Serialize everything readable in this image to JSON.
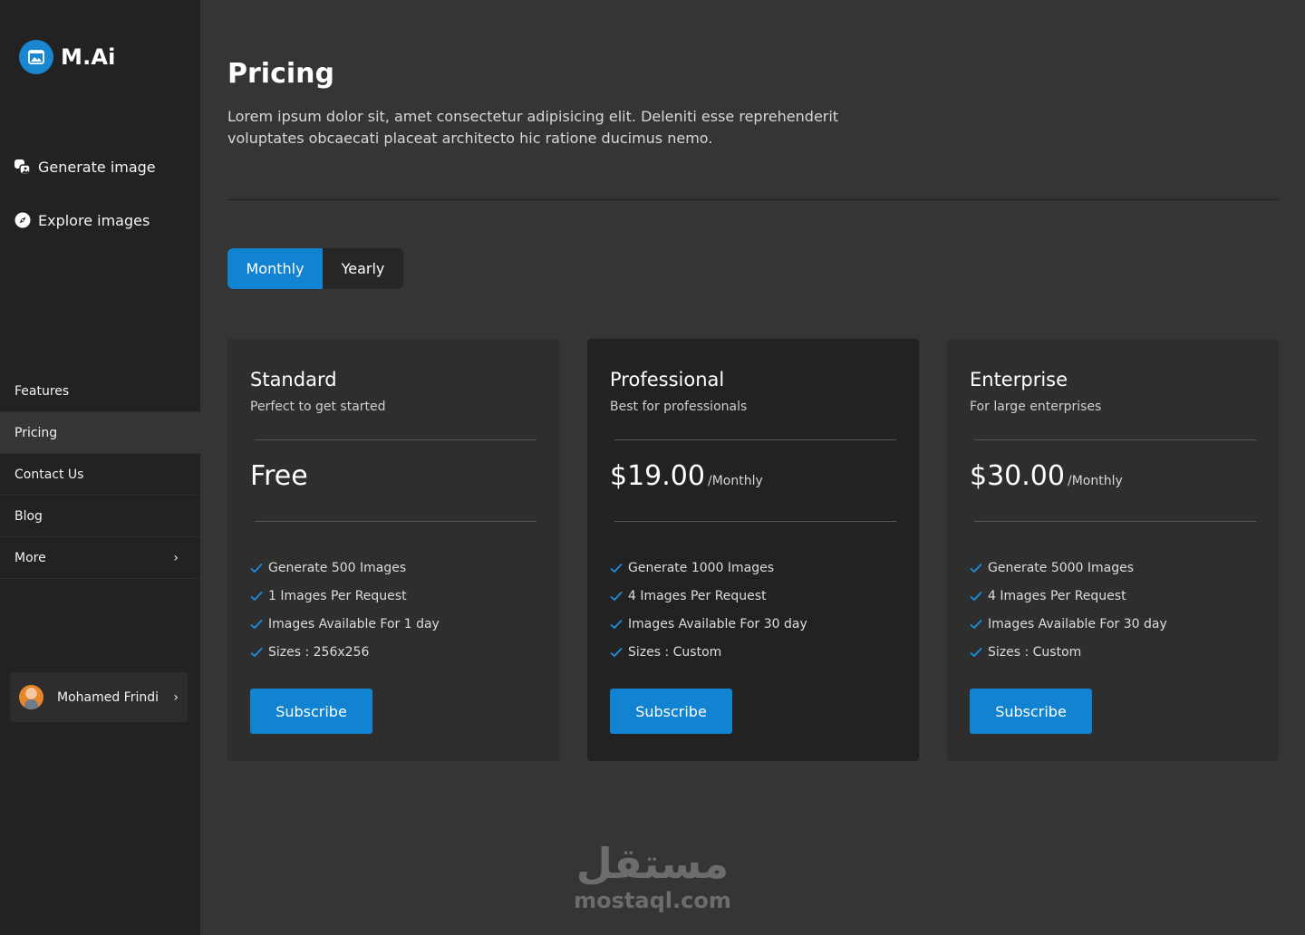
{
  "app": {
    "name": "M.Ai",
    "logo_icon": "image-icon"
  },
  "primary_nav": [
    {
      "label": "Generate image",
      "icon": "generate-image-icon"
    },
    {
      "label": "Explore images",
      "icon": "compass-icon"
    }
  ],
  "secondary_nav": [
    {
      "label": "Features",
      "active": false
    },
    {
      "label": "Pricing",
      "active": true
    },
    {
      "label": "Contact Us",
      "active": false
    },
    {
      "label": "Blog",
      "active": false
    },
    {
      "label": "More",
      "active": false,
      "chevron": "›"
    }
  ],
  "user": {
    "name": "Mohamed Frindi",
    "chevron": "›"
  },
  "page": {
    "title": "Pricing",
    "description": "Lorem ipsum dolor sit, amet consectetur adipisicing elit. Deleniti esse reprehenderit voluptates obcaecati placeat architecto hic ratione ducimus nemo."
  },
  "billing_toggle": {
    "monthly": "Monthly",
    "yearly": "Yearly",
    "selected": "Monthly"
  },
  "plans": [
    {
      "name": "Standard",
      "tagline": "Perfect to get started",
      "price": "Free",
      "period": "",
      "features": [
        "Generate 500 Images",
        "1 Images Per Request",
        "Images Available For 1 day",
        "Sizes : 256x256"
      ],
      "cta": "Subscribe"
    },
    {
      "name": "Professional",
      "tagline": "Best for professionals",
      "price": "$19.00",
      "period": "/Monthly",
      "features": [
        "Generate 1000 Images",
        "4 Images Per Request",
        "Images Available For 30 day",
        "Sizes : Custom"
      ],
      "cta": "Subscribe"
    },
    {
      "name": "Enterprise",
      "tagline": "For large enterprises",
      "price": "$30.00",
      "period": "/Monthly",
      "features": [
        "Generate 5000 Images",
        "4 Images Per Request",
        "Images Available For 30 day",
        "Sizes : Custom"
      ],
      "cta": "Subscribe"
    }
  ],
  "watermark": {
    "arabic": "مستقل",
    "latin": "mostaql.com"
  },
  "colors": {
    "accent": "#1183d0",
    "sidebar_bg": "#222222",
    "main_bg": "#353535",
    "card_bg": "#2e2e2e",
    "card_featured_bg": "#222222"
  }
}
